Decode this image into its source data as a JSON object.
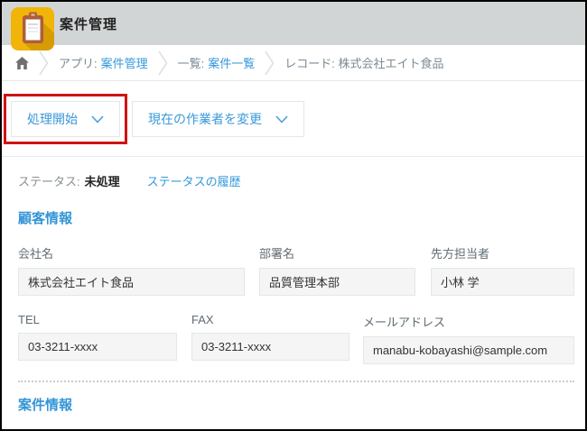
{
  "app": {
    "title": "案件管理"
  },
  "breadcrumb": {
    "app_prefix": "アプリ:",
    "app_link": "案件管理",
    "list_prefix": "一覧:",
    "list_link": "案件一覧",
    "record_label": "レコード: 株式会社エイト食品"
  },
  "toolbar": {
    "process_start_label": "処理開始",
    "change_worker_label": "現在の作業者を変更"
  },
  "status": {
    "label": "ステータス:",
    "value": "未処理",
    "history_link": "ステータスの履歴"
  },
  "sections": {
    "customer_info": "顧客情報",
    "case_info": "案件情報"
  },
  "fields": [
    {
      "label": "会社名",
      "value": "株式会社エイト食品"
    },
    {
      "label": "部署名",
      "value": "品質管理本部"
    },
    {
      "label": "先方担当者",
      "value": "小林 学"
    },
    {
      "label": "TEL",
      "value": "03-3211-xxxx"
    },
    {
      "label": "FAX",
      "value": "03-3211-xxxx"
    },
    {
      "label": "メールアドレス",
      "value": "manabu-kobayashi@sample.com"
    }
  ],
  "icons": {
    "app_icon": "clipboard-icon",
    "home": "home-icon",
    "separator": "chevron-right-icon",
    "dropdown": "chevron-down-icon"
  },
  "colors": {
    "header_gray": "#d2d5d6",
    "link_blue": "#3498db",
    "annotation_red": "#d01212",
    "icon_gold": "#f1b408",
    "icon_gold_shadow": "#d79c04",
    "clipboard_brown": "#ad5f3b",
    "field_bg": "#f5f5f5",
    "field_border": "#e3e7e8"
  }
}
